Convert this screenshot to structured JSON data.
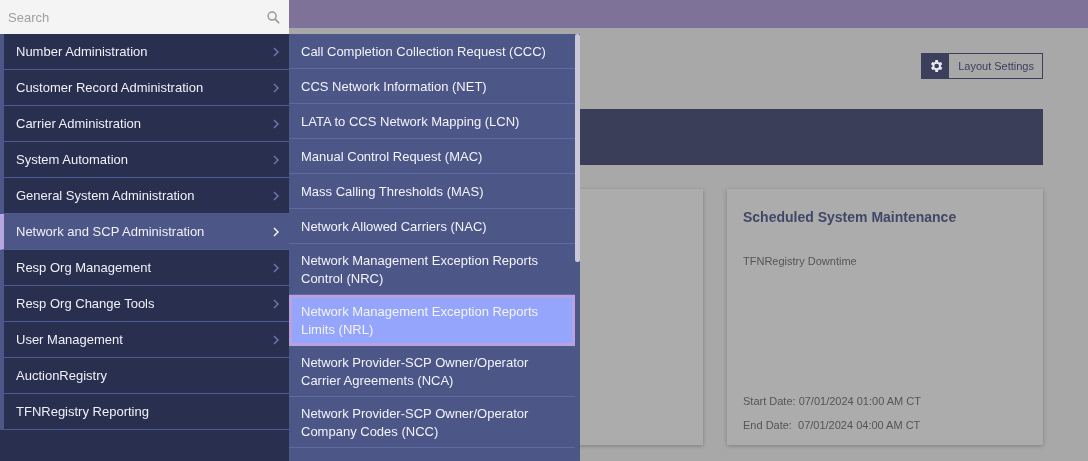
{
  "search": {
    "placeholder": "Search"
  },
  "menu": [
    {
      "label": "Number Administration",
      "has_submenu": true,
      "selected": false
    },
    {
      "label": "Customer Record Administration",
      "has_submenu": true,
      "selected": false
    },
    {
      "label": "Carrier Administration",
      "has_submenu": true,
      "selected": false
    },
    {
      "label": "System Automation",
      "has_submenu": true,
      "selected": false
    },
    {
      "label": "General System Administration",
      "has_submenu": true,
      "selected": false
    },
    {
      "label": "Network and SCP Administration",
      "has_submenu": true,
      "selected": true
    },
    {
      "label": "Resp Org Management",
      "has_submenu": true,
      "selected": false
    },
    {
      "label": "Resp Org Change Tools",
      "has_submenu": true,
      "selected": false
    },
    {
      "label": "User Management",
      "has_submenu": true,
      "selected": false
    },
    {
      "label": "AuctionRegistry",
      "has_submenu": false,
      "selected": false
    },
    {
      "label": "TFNRegistry Reporting",
      "has_submenu": false,
      "selected": false
    }
  ],
  "submenu": [
    {
      "label": "Call Completion Collection Request (CCC)",
      "selected": false
    },
    {
      "label": "CCS Network Information (NET)",
      "selected": false
    },
    {
      "label": "LATA to CCS Network Mapping (LCN)",
      "selected": false
    },
    {
      "label": "Manual Control Request (MAC)",
      "selected": false
    },
    {
      "label": "Mass Calling Thresholds (MAS)",
      "selected": false
    },
    {
      "label": "Network Allowed Carriers (NAC)",
      "selected": false
    },
    {
      "label": "Network Management Exception Reports Control (NRC)",
      "selected": false
    },
    {
      "label": "Network Management Exception Reports Limits (NRL)",
      "selected": true
    },
    {
      "label": "Network Provider-SCP Owner/Operator Carrier Agreements (NCA)",
      "selected": false
    },
    {
      "label": "Network Provider-SCP Owner/Operator Company Codes (NCC)",
      "selected": false
    }
  ],
  "layout_settings": {
    "label": "Layout Settings"
  },
  "maintenance_card": {
    "title": "Scheduled System Maintenance",
    "subtitle": "TFNRegistry Downtime",
    "start": "Start Date: 07/01/2024 01:00 AM CT",
    "end": "End Date:  07/01/2024 04:00 AM CT"
  }
}
